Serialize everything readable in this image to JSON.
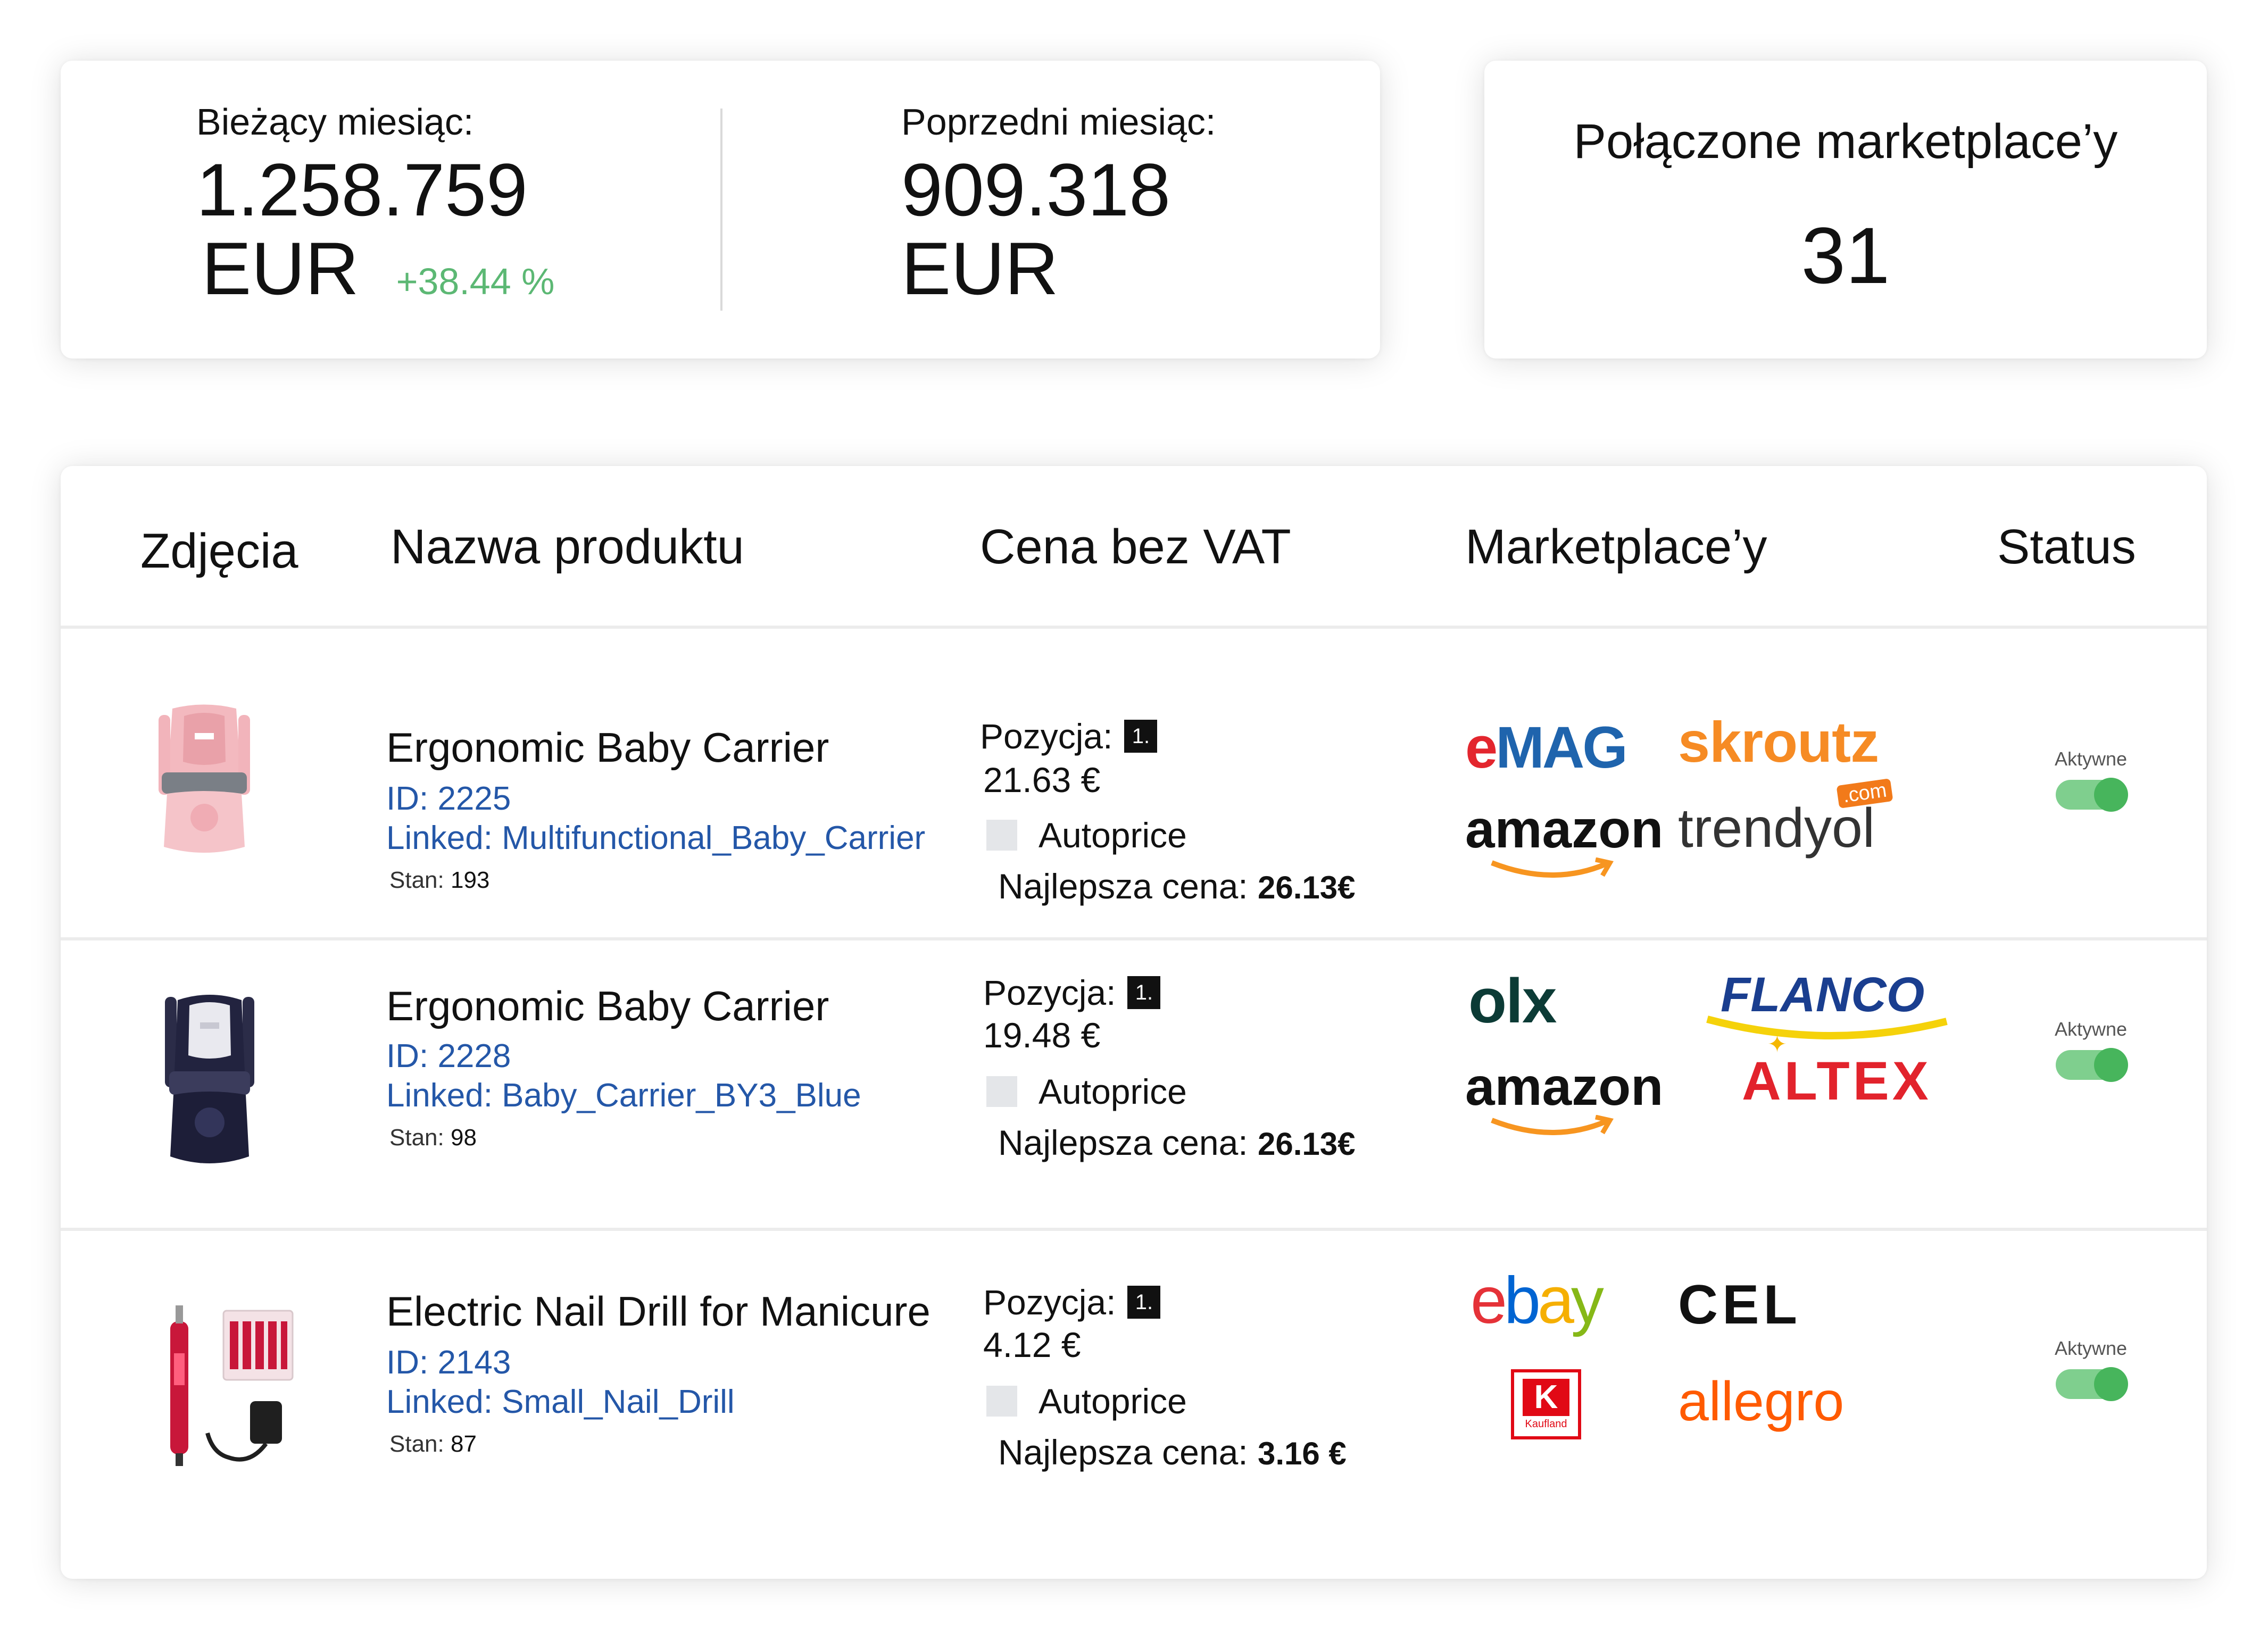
{
  "stats": {
    "current_label": "Bieżący miesiąc:",
    "current_value": "1.258.759",
    "current_currency": "EUR",
    "current_change": "+38.44 %",
    "previous_label": "Poprzedni miesiąc:",
    "previous_value": "909.318",
    "previous_currency": "EUR"
  },
  "marketplaces_card": {
    "title": "Połączone marketplace’y",
    "count": "31"
  },
  "table": {
    "headers": {
      "photos": "Zdjęcia",
      "name": "Nazwa produktu",
      "price": "Cena bez VAT",
      "marketplaces": "Marketplace’y",
      "status": "Status"
    },
    "labels": {
      "position": "Pozycja:",
      "autoprice": "Autoprice",
      "best_price": "Najlepsza cena:",
      "stock": "Stan:"
    },
    "rows": [
      {
        "name": "Ergonomic Baby Carrier",
        "id": "ID: 2225",
        "linked": "Linked: Multifunctional_Baby_Carrier",
        "stock": "193",
        "position": "1.",
        "price": "21.63 €",
        "best_price": "26.13€",
        "status": "Aktywne",
        "status_on": true,
        "logos": [
          "eMAG",
          "skroutz",
          "amazon",
          "trendyol"
        ]
      },
      {
        "name": "Ergonomic Baby Carrier",
        "id": "ID: 2228",
        "linked": "Linked: Baby_Carrier_BY3_Blue",
        "stock": "98",
        "position": "1.",
        "price": "19.48 €",
        "best_price": "26.13€",
        "status": "Aktywne",
        "status_on": true,
        "logos": [
          "olx",
          "FLANCO",
          "amazon",
          "ALTEX"
        ]
      },
      {
        "name": "Electric Nail Drill for Manicure",
        "id": "ID: 2143",
        "linked": "Linked:  Small_Nail_Drill",
        "stock": "87",
        "position": "1.",
        "price": "4.12 €",
        "best_price": "3.16 €",
        "status": "Aktywne",
        "status_on": true,
        "logos": [
          "ebay",
          "CEL",
          "Kaufland",
          "allegro"
        ]
      }
    ]
  },
  "logo_extras": {
    "trendyol_com": ".com"
  },
  "colors": {
    "accent_blue": "#2457a8",
    "positive": "#5cb874",
    "toggle_on": "#47b55c",
    "emag_red": "#e3262e",
    "emag_blue": "#1f64ad",
    "skroutz": "#f68b24",
    "amazon_smile": "#f79520",
    "flanco_blue": "#1a3e8f",
    "flanco_yellow": "#f5d20a",
    "altex_red": "#e2232c",
    "allegro": "#ff5a00",
    "kaufland_red": "#e10915"
  }
}
